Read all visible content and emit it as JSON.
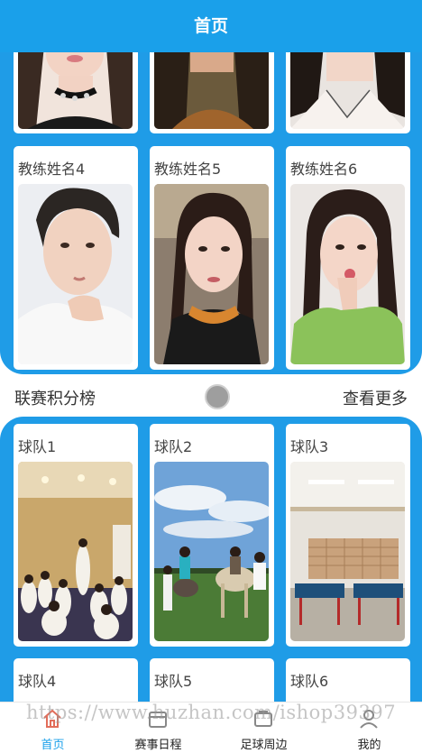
{
  "header": {
    "title": "首页"
  },
  "coaches": [
    {
      "name": "教练姓名4"
    },
    {
      "name": "教练姓名5"
    },
    {
      "name": "教练姓名6"
    }
  ],
  "standings": {
    "title": "联赛积分榜",
    "more": "查看更多"
  },
  "teams": [
    {
      "name": "球队1"
    },
    {
      "name": "球队2"
    },
    {
      "name": "球队3"
    },
    {
      "name": "球队4"
    },
    {
      "name": "球队5"
    },
    {
      "name": "球队6"
    }
  ],
  "tabbar": {
    "items": [
      {
        "label": "首页",
        "icon": "home-icon",
        "active": true
      },
      {
        "label": "赛事日程",
        "icon": "calendar-icon",
        "active": false
      },
      {
        "label": "足球周边",
        "icon": "shop-icon",
        "active": false
      },
      {
        "label": "我的",
        "icon": "user-icon",
        "active": false
      }
    ]
  },
  "watermark": "https://www.huzhan.com/ishop39397",
  "colors": {
    "primary": "#1f9ce7",
    "header": "#1aa0ea",
    "active_tab": "#1aa0ea"
  }
}
